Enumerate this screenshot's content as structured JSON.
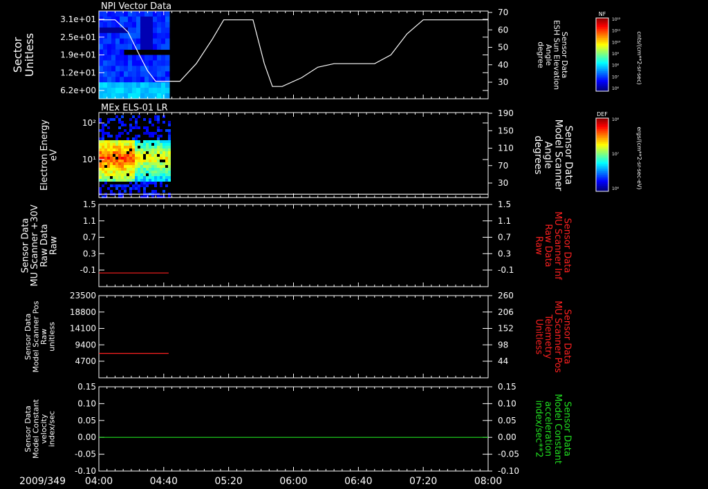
{
  "chart_data": {
    "type": "line",
    "date_label": "2009/349",
    "time_ticks": [
      "04:00",
      "04:40",
      "05:20",
      "06:00",
      "06:40",
      "07:20",
      "08:00"
    ],
    "panels": [
      {
        "id": "p1",
        "title": "NPI Vector Data",
        "left_label": [
          "Sector",
          "Unitless"
        ],
        "left_ticks": [
          "3.1e+01",
          "2.5e+01",
          "1.9e+01",
          "1.2e+01",
          "6.2e+00"
        ],
        "right_label": [
          "Sensor Data",
          "ESH Sun Elevation",
          "Angle",
          "degree"
        ],
        "right_color": "#ffffff",
        "right_ticks": [
          "70",
          "60",
          "50",
          "40",
          "30"
        ],
        "right_range": [
          20,
          70
        ],
        "spectrogram_span": [
          "04:00",
          "04:43"
        ],
        "series": {
          "name": "",
          "color": "#ffffff",
          "x": [
            "04:00",
            "04:10",
            "04:18",
            "04:25",
            "04:30",
            "04:35",
            "04:50",
            "05:00",
            "05:10",
            "05:17",
            "05:23",
            "05:35",
            "05:42",
            "05:47",
            "05:53",
            "06:05",
            "06:15",
            "06:25",
            "06:35",
            "06:50",
            "07:00",
            "07:10",
            "07:20",
            "07:25",
            "08:00"
          ],
          "y": [
            65,
            65,
            58,
            45,
            36,
            30,
            30,
            40,
            54,
            65,
            65,
            65,
            40,
            27,
            27,
            32,
            38,
            40,
            40,
            40,
            45,
            57,
            65,
            65,
            65
          ]
        },
        "colorbar": {
          "label": "NF",
          "units": "cnts/(cm**2-sr-sec)",
          "ticks": [
            "10¹²",
            "10¹¹",
            "10¹⁰",
            "10⁹",
            "10⁸",
            "10⁷",
            "10⁶"
          ]
        }
      },
      {
        "id": "p2",
        "title": "MEx ELS-01 LR",
        "left_label": [
          "Electron Energy",
          "eV"
        ],
        "left_ticks": [
          "10²",
          "10¹"
        ],
        "right_label": [
          "Sensor Data",
          "Model Scanner",
          "Angle",
          "degrees"
        ],
        "right_color": "#ffffff",
        "right_ticks": [
          "190",
          "150",
          "110",
          "70",
          "30"
        ],
        "right_range": [
          10,
          190
        ],
        "spectrogram_span": [
          "04:00",
          "04:43"
        ],
        "series": {
          "name": "",
          "color": "#ffffff",
          "x": [
            "04:00",
            "08:00"
          ],
          "y": [
            17,
            17
          ]
        },
        "colorbar": {
          "label": "DEF",
          "units": "ergs/(cm**2-sr-sec-eV)",
          "ticks": [
            "10⁸",
            "10⁷",
            "10⁶"
          ]
        }
      },
      {
        "id": "p3",
        "title": "",
        "left_label": [
          "Sensor Data",
          "MU Scanner +30V",
          "Raw Data",
          "Raw"
        ],
        "left_ticks": [
          "1.5",
          "1.1",
          "0.7",
          "0.3",
          "-0.1"
        ],
        "left_range": [
          -0.3,
          1.5
        ],
        "right_label": [
          "Sensor Data",
          "MU Scanner Inf",
          "Raw Data",
          "Raw"
        ],
        "right_color": "#ff2020",
        "right_ticks": [
          "1.5",
          "1.1",
          "0.7",
          "0.3",
          "-0.1"
        ],
        "series": {
          "name": "",
          "color": "#ff2020",
          "x": [
            "04:00",
            "04:43"
          ],
          "y": [
            0.0,
            0.0
          ]
        }
      },
      {
        "id": "p4",
        "title": "",
        "left_label": [
          "Sensor Data",
          "Model Scanner Pos",
          "Raw",
          "unitless"
        ],
        "left_ticks": [
          "23500",
          "18800",
          "14100",
          "9400",
          "4700"
        ],
        "left_range": [
          0,
          23500
        ],
        "right_label": [
          "Sensor Data",
          "MU Scanner Pos",
          "Telemetry",
          "Unitless"
        ],
        "right_color": "#ff2020",
        "right_ticks": [
          "260",
          "206",
          "152",
          "98",
          "44"
        ],
        "series": {
          "name": "",
          "color": "#ff2020",
          "x": [
            "04:00",
            "04:43"
          ],
          "y": [
            7000,
            7000
          ]
        }
      },
      {
        "id": "p5",
        "title": "",
        "left_label": [
          "Sensor Data",
          "Model Constant",
          "velocity",
          "index/sec"
        ],
        "left_ticks": [
          "0.15",
          "0.10",
          "0.05",
          "0.00",
          "-0.05",
          "-0.10"
        ],
        "left_range": [
          -0.1,
          0.15
        ],
        "right_label": [
          "Sensor Data",
          "Model Constant",
          "acceleration",
          "index/sec**2"
        ],
        "right_color": "#20e020",
        "right_ticks": [
          "0.15",
          "0.10",
          "0.05",
          "0.00",
          "-0.05",
          "-0.10"
        ],
        "series": {
          "name": "",
          "color": "#20e020",
          "x": [
            "04:00",
            "08:00"
          ],
          "y": [
            0.0,
            0.0
          ]
        }
      }
    ]
  }
}
